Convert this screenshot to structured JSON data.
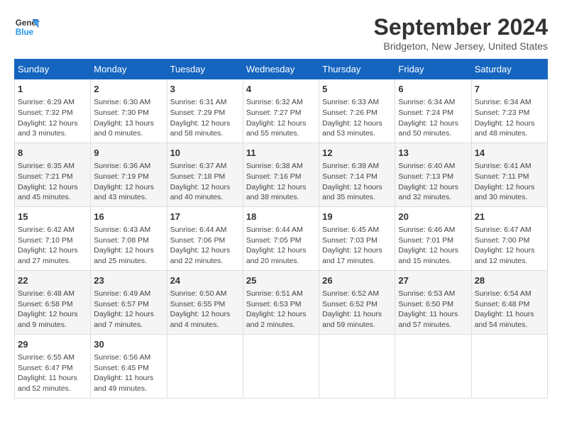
{
  "header": {
    "logo_line1": "General",
    "logo_line2": "Blue",
    "month": "September 2024",
    "location": "Bridgeton, New Jersey, United States"
  },
  "days_of_week": [
    "Sunday",
    "Monday",
    "Tuesday",
    "Wednesday",
    "Thursday",
    "Friday",
    "Saturday"
  ],
  "weeks": [
    [
      {
        "day": "1",
        "rise": "Sunrise: 6:29 AM",
        "set": "Sunset: 7:32 PM",
        "daylight": "Daylight: 12 hours and 3 minutes."
      },
      {
        "day": "2",
        "rise": "Sunrise: 6:30 AM",
        "set": "Sunset: 7:30 PM",
        "daylight": "Daylight: 13 hours and 0 minutes."
      },
      {
        "day": "3",
        "rise": "Sunrise: 6:31 AM",
        "set": "Sunset: 7:29 PM",
        "daylight": "Daylight: 12 hours and 58 minutes."
      },
      {
        "day": "4",
        "rise": "Sunrise: 6:32 AM",
        "set": "Sunset: 7:27 PM",
        "daylight": "Daylight: 12 hours and 55 minutes."
      },
      {
        "day": "5",
        "rise": "Sunrise: 6:33 AM",
        "set": "Sunset: 7:26 PM",
        "daylight": "Daylight: 12 hours and 53 minutes."
      },
      {
        "day": "6",
        "rise": "Sunrise: 6:34 AM",
        "set": "Sunset: 7:24 PM",
        "daylight": "Daylight: 12 hours and 50 minutes."
      },
      {
        "day": "7",
        "rise": "Sunrise: 6:34 AM",
        "set": "Sunset: 7:23 PM",
        "daylight": "Daylight: 12 hours and 48 minutes."
      }
    ],
    [
      {
        "day": "8",
        "rise": "Sunrise: 6:35 AM",
        "set": "Sunset: 7:21 PM",
        "daylight": "Daylight: 12 hours and 45 minutes."
      },
      {
        "day": "9",
        "rise": "Sunrise: 6:36 AM",
        "set": "Sunset: 7:19 PM",
        "daylight": "Daylight: 12 hours and 43 minutes."
      },
      {
        "day": "10",
        "rise": "Sunrise: 6:37 AM",
        "set": "Sunset: 7:18 PM",
        "daylight": "Daylight: 12 hours and 40 minutes."
      },
      {
        "day": "11",
        "rise": "Sunrise: 6:38 AM",
        "set": "Sunset: 7:16 PM",
        "daylight": "Daylight: 12 hours and 38 minutes."
      },
      {
        "day": "12",
        "rise": "Sunrise: 6:39 AM",
        "set": "Sunset: 7:14 PM",
        "daylight": "Daylight: 12 hours and 35 minutes."
      },
      {
        "day": "13",
        "rise": "Sunrise: 6:40 AM",
        "set": "Sunset: 7:13 PM",
        "daylight": "Daylight: 12 hours and 32 minutes."
      },
      {
        "day": "14",
        "rise": "Sunrise: 6:41 AM",
        "set": "Sunset: 7:11 PM",
        "daylight": "Daylight: 12 hours and 30 minutes."
      }
    ],
    [
      {
        "day": "15",
        "rise": "Sunrise: 6:42 AM",
        "set": "Sunset: 7:10 PM",
        "daylight": "Daylight: 12 hours and 27 minutes."
      },
      {
        "day": "16",
        "rise": "Sunrise: 6:43 AM",
        "set": "Sunset: 7:08 PM",
        "daylight": "Daylight: 12 hours and 25 minutes."
      },
      {
        "day": "17",
        "rise": "Sunrise: 6:44 AM",
        "set": "Sunset: 7:06 PM",
        "daylight": "Daylight: 12 hours and 22 minutes."
      },
      {
        "day": "18",
        "rise": "Sunrise: 6:44 AM",
        "set": "Sunset: 7:05 PM",
        "daylight": "Daylight: 12 hours and 20 minutes."
      },
      {
        "day": "19",
        "rise": "Sunrise: 6:45 AM",
        "set": "Sunset: 7:03 PM",
        "daylight": "Daylight: 12 hours and 17 minutes."
      },
      {
        "day": "20",
        "rise": "Sunrise: 6:46 AM",
        "set": "Sunset: 7:01 PM",
        "daylight": "Daylight: 12 hours and 15 minutes."
      },
      {
        "day": "21",
        "rise": "Sunrise: 6:47 AM",
        "set": "Sunset: 7:00 PM",
        "daylight": "Daylight: 12 hours and 12 minutes."
      }
    ],
    [
      {
        "day": "22",
        "rise": "Sunrise: 6:48 AM",
        "set": "Sunset: 6:58 PM",
        "daylight": "Daylight: 12 hours and 9 minutes."
      },
      {
        "day": "23",
        "rise": "Sunrise: 6:49 AM",
        "set": "Sunset: 6:57 PM",
        "daylight": "Daylight: 12 hours and 7 minutes."
      },
      {
        "day": "24",
        "rise": "Sunrise: 6:50 AM",
        "set": "Sunset: 6:55 PM",
        "daylight": "Daylight: 12 hours and 4 minutes."
      },
      {
        "day": "25",
        "rise": "Sunrise: 6:51 AM",
        "set": "Sunset: 6:53 PM",
        "daylight": "Daylight: 12 hours and 2 minutes."
      },
      {
        "day": "26",
        "rise": "Sunrise: 6:52 AM",
        "set": "Sunset: 6:52 PM",
        "daylight": "Daylight: 11 hours and 59 minutes."
      },
      {
        "day": "27",
        "rise": "Sunrise: 6:53 AM",
        "set": "Sunset: 6:50 PM",
        "daylight": "Daylight: 11 hours and 57 minutes."
      },
      {
        "day": "28",
        "rise": "Sunrise: 6:54 AM",
        "set": "Sunset: 6:48 PM",
        "daylight": "Daylight: 11 hours and 54 minutes."
      }
    ],
    [
      {
        "day": "29",
        "rise": "Sunrise: 6:55 AM",
        "set": "Sunset: 6:47 PM",
        "daylight": "Daylight: 11 hours and 52 minutes."
      },
      {
        "day": "30",
        "rise": "Sunrise: 6:56 AM",
        "set": "Sunset: 6:45 PM",
        "daylight": "Daylight: 11 hours and 49 minutes."
      },
      {
        "day": "",
        "rise": "",
        "set": "",
        "daylight": ""
      },
      {
        "day": "",
        "rise": "",
        "set": "",
        "daylight": ""
      },
      {
        "day": "",
        "rise": "",
        "set": "",
        "daylight": ""
      },
      {
        "day": "",
        "rise": "",
        "set": "",
        "daylight": ""
      },
      {
        "day": "",
        "rise": "",
        "set": "",
        "daylight": ""
      }
    ]
  ]
}
